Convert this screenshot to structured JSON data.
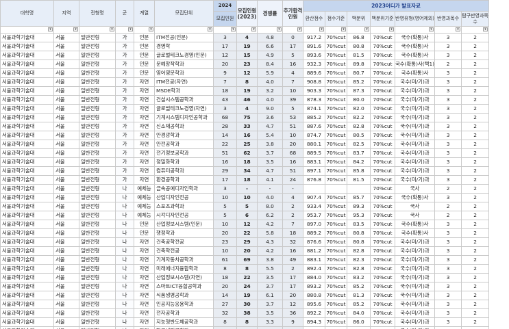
{
  "headers": {
    "univ": "대학명",
    "region": "지역",
    "type": "전형명",
    "gun": "군",
    "field": "계열",
    "dept": "모집단위",
    "y2024": "2024",
    "quota2024": "모집인원",
    "quota2023": "모집인원(2023)",
    "comp": "경쟁률",
    "extra": "추가합격인원",
    "group2023": "2023어디가 발표자료",
    "conv": "환산점수",
    "basis": "점수기준",
    "pct": "백분위",
    "pct_basis": "백분위기준",
    "reflect": "반영유형(영어제외)",
    "subj": "반영과목수",
    "inq": "탐구반영과목수"
  },
  "rows": [
    [
      "서울과학기술대",
      "서울",
      "일반전형",
      "가",
      "인문",
      "ITM전공(인문)",
      "3",
      "4",
      "4.8",
      "0",
      "917.2",
      "70%cut",
      "86.8",
      "70%cut",
      "국수(확통)사",
      "3",
      "2"
    ],
    [
      "서울과학기술대",
      "서울",
      "일반전형",
      "가",
      "인문",
      "경영학",
      "17",
      "19",
      "6.6",
      "17",
      "891.6",
      "70%cut",
      "80.8",
      "70%cut",
      "국수(확통)사",
      "3",
      "2"
    ],
    [
      "서울과학기술대",
      "서울",
      "일반전형",
      "가",
      "인문",
      "글로벌테크노경영(인문)",
      "12",
      "15",
      "4.9",
      "5",
      "893.6",
      "70%cut",
      "81.5",
      "70%cut",
      "국수(확통)사",
      "3",
      "2"
    ],
    [
      "서울과학기술대",
      "서울",
      "일반전형",
      "가",
      "인문",
      "문예창작학과",
      "20",
      "23",
      "8.4",
      "16",
      "932.3",
      "70%cut",
      "89.8",
      "70%cut",
      "국수(확통)사(택1)",
      "2",
      "2"
    ],
    [
      "서울과학기술대",
      "서울",
      "일반전형",
      "가",
      "인문",
      "영어영문학과",
      "9",
      "12",
      "5.9",
      "4",
      "889.6",
      "70%cut",
      "80.7",
      "70%cut",
      "국수(확통)사",
      "3",
      "2"
    ],
    [
      "서울과학기술대",
      "서울",
      "일반전형",
      "가",
      "자연",
      "ITM전공(자연)",
      "7",
      "8",
      "4.0",
      "7",
      "908.8",
      "70%cut",
      "85.2",
      "70%cut",
      "국수(미/기)과",
      "3",
      "2"
    ],
    [
      "서울과학기술대",
      "서울",
      "일반전형",
      "가",
      "자연",
      "MSDE학과",
      "18",
      "19",
      "3.2",
      "10",
      "903.3",
      "70%cut",
      "87.3",
      "70%cut",
      "국수(미/기)과",
      "3",
      "2"
    ],
    [
      "서울과학기술대",
      "서울",
      "일반전형",
      "가",
      "자연",
      "건설시스템공학과",
      "43",
      "46",
      "4.0",
      "39",
      "878.3",
      "70%cut",
      "80.0",
      "70%cut",
      "국수(미/기)과",
      "3",
      "2"
    ],
    [
      "서울과학기술대",
      "서울",
      "일반전형",
      "가",
      "자연",
      "글로벌테크노경영(자연)",
      "3",
      "4",
      "9.0",
      "5",
      "874.1",
      "70%cut",
      "82.0",
      "70%cut",
      "국수(미/기)과",
      "3",
      "2"
    ],
    [
      "서울과학기술대",
      "서울",
      "일반전형",
      "가",
      "자연",
      "기계시스템디자인공학과",
      "68",
      "75",
      "3.6",
      "53",
      "885.2",
      "70%cut",
      "82.2",
      "70%cut",
      "국수(미/기)과",
      "3",
      "2"
    ],
    [
      "서울과학기술대",
      "서울",
      "일반전형",
      "가",
      "자연",
      "신소재공학과",
      "28",
      "33",
      "4.7",
      "51",
      "887.6",
      "70%cut",
      "82.8",
      "70%cut",
      "국수(미/기)과",
      "3",
      "2"
    ],
    [
      "서울과학기술대",
      "서울",
      "일반전형",
      "가",
      "자연",
      "안경광학과",
      "14",
      "16",
      "5.4",
      "10",
      "874.7",
      "70%cut",
      "80.5",
      "70%cut",
      "국수(미/기)과",
      "3",
      "2"
    ],
    [
      "서울과학기술대",
      "서울",
      "일반전형",
      "가",
      "자연",
      "안전공학과",
      "22",
      "25",
      "3.8",
      "20",
      "880.1",
      "70%cut",
      "82.5",
      "70%cut",
      "국수(미/기)과",
      "3",
      "2"
    ],
    [
      "서울과학기술대",
      "서울",
      "일반전형",
      "가",
      "자연",
      "전기정보공학과",
      "51",
      "62",
      "3.7",
      "68",
      "889.5",
      "70%cut",
      "83.7",
      "70%cut",
      "국수(미/기)과",
      "3",
      "2"
    ],
    [
      "서울과학기술대",
      "서울",
      "일반전형",
      "가",
      "자연",
      "정밀화학과",
      "16",
      "18",
      "3.5",
      "16",
      "883.1",
      "70%cut",
      "84.2",
      "70%cut",
      "국수(미/기)과",
      "3",
      "2"
    ],
    [
      "서울과학기술대",
      "서울",
      "일반전형",
      "가",
      "자연",
      "컴퓨터공학과",
      "29",
      "34",
      "4.7",
      "51",
      "897.1",
      "70%cut",
      "85.8",
      "70%cut",
      "국수(미/기)과",
      "3",
      "2"
    ],
    [
      "서울과학기술대",
      "서울",
      "일반전형",
      "가",
      "자연",
      "환경공학과",
      "17",
      "18",
      "4.1",
      "24",
      "876.8",
      "70%cut",
      "81.5",
      "70%cut",
      "국수(미/기)과",
      "3",
      "2"
    ],
    [
      "서울과학기술대",
      "서울",
      "일반전형",
      "나",
      "예체능",
      "금속공예디자인학과",
      "3",
      "-",
      "-",
      "-",
      "",
      "",
      "",
      "70%cut",
      "국사",
      "2",
      "2"
    ],
    [
      "서울과학기술대",
      "서울",
      "일반전형",
      "나",
      "예체능",
      "산업디자인전공",
      "10",
      "10",
      "4.0",
      "4",
      "907.4",
      "70%cut",
      "85.7",
      "70%cut",
      "국수(확통)사",
      "3",
      "2"
    ],
    [
      "서울과학기술대",
      "서울",
      "일반전형",
      "나",
      "예체능",
      "스포츠과학과",
      "5",
      "5",
      "8.0",
      "2",
      "933.4",
      "70%cut",
      "89.3",
      "70%cut",
      "국사",
      "2",
      "2"
    ],
    [
      "서울과학기술대",
      "서울",
      "일반전형",
      "나",
      "예체능",
      "시각디자인전공",
      "5",
      "6",
      "6.2",
      "2",
      "953.7",
      "70%cut",
      "95.3",
      "70%cut",
      "국사",
      "2",
      "2"
    ],
    [
      "서울과학기술대",
      "서울",
      "일반전형",
      "나",
      "인문",
      "산업정보시스템(인문)",
      "10",
      "12",
      "4.2",
      "7",
      "897.0",
      "70%cut",
      "83.5",
      "70%cut",
      "국수(확통)사",
      "3",
      "2"
    ],
    [
      "서울과학기술대",
      "서울",
      "일반전형",
      "나",
      "인문",
      "행정학과",
      "20",
      "22",
      "5.8",
      "18",
      "889.2",
      "70%cut",
      "80.8",
      "70%cut",
      "국수(확통)사",
      "3",
      "2"
    ],
    [
      "서울과학기술대",
      "서울",
      "일반전형",
      "나",
      "자연",
      "건축공학전공",
      "23",
      "29",
      "4.3",
      "32",
      "876.6",
      "70%cut",
      "80.8",
      "70%cut",
      "국수(미/기)과",
      "3",
      "2"
    ],
    [
      "서울과학기술대",
      "서울",
      "일반전형",
      "나",
      "자연",
      "건축학전공",
      "10",
      "20",
      "4.2",
      "16",
      "881.2",
      "70%cut",
      "82.8",
      "70%cut",
      "국수(미/기)과",
      "3",
      "2"
    ],
    [
      "서울과학기술대",
      "서울",
      "일반전형",
      "나",
      "자연",
      "기계자동차공학과",
      "61",
      "69",
      "3.8",
      "49",
      "883.1",
      "70%cut",
      "82.3",
      "70%cut",
      "국수(미/기)과",
      "3",
      "2"
    ],
    [
      "서울과학기술대",
      "서울",
      "일반전형",
      "나",
      "자연",
      "미래에너지융합학과",
      "8",
      "8",
      "5.5",
      "2",
      "892.4",
      "70%cut",
      "82.8",
      "70%cut",
      "국수(미/기)과",
      "3",
      "2"
    ],
    [
      "서울과학기술대",
      "서울",
      "일반전형",
      "나",
      "자연",
      "산업정보시스템(자연)",
      "18",
      "22",
      "3.5",
      "17",
      "884.0",
      "70%cut",
      "83.2",
      "70%cut",
      "국수(미/기)과",
      "3",
      "2"
    ],
    [
      "서울과학기술대",
      "서울",
      "일반전형",
      "나",
      "자연",
      "스마트ICT융합공학과",
      "20",
      "24",
      "3.7",
      "17",
      "893.2",
      "70%cut",
      "85.2",
      "70%cut",
      "국수(미/기)과",
      "3",
      "2"
    ],
    [
      "서울과학기술대",
      "서울",
      "일반전형",
      "나",
      "자연",
      "식품생명공학과",
      "14",
      "19",
      "6.1",
      "20",
      "880.8",
      "70%cut",
      "81.3",
      "70%cut",
      "국수(미/기)과",
      "3",
      "2"
    ],
    [
      "서울과학기술대",
      "서울",
      "일반전형",
      "나",
      "자연",
      "인공지능응용학과",
      "27",
      "30",
      "3.7",
      "12",
      "895.6",
      "70%cut",
      "85.2",
      "70%cut",
      "국수(미/기)과",
      "3",
      "2"
    ],
    [
      "서울과학기술대",
      "서울",
      "일반전형",
      "나",
      "자연",
      "전자공학과",
      "32",
      "38",
      "3.5",
      "36",
      "892.2",
      "70%cut",
      "84.0",
      "70%cut",
      "국수(미/기)과",
      "3",
      "2"
    ],
    [
      "서울과학기술대",
      "서울",
      "일반전형",
      "나",
      "자연",
      "지능형반도체공학과",
      "8",
      "8",
      "3.3",
      "9",
      "894.3",
      "70%cut",
      "86.0",
      "70%cut",
      "국수(미/기)과",
      "3",
      "2"
    ],
    [
      "서울과학기술대",
      "서울",
      "일반전형",
      "나",
      "자연",
      "화공생명공학과",
      "30",
      "31",
      "4.1",
      "29",
      "887.9",
      "70%cut",
      "84.0",
      "70%cut",
      "국수(미/기)과",
      "3",
      "2"
    ]
  ]
}
